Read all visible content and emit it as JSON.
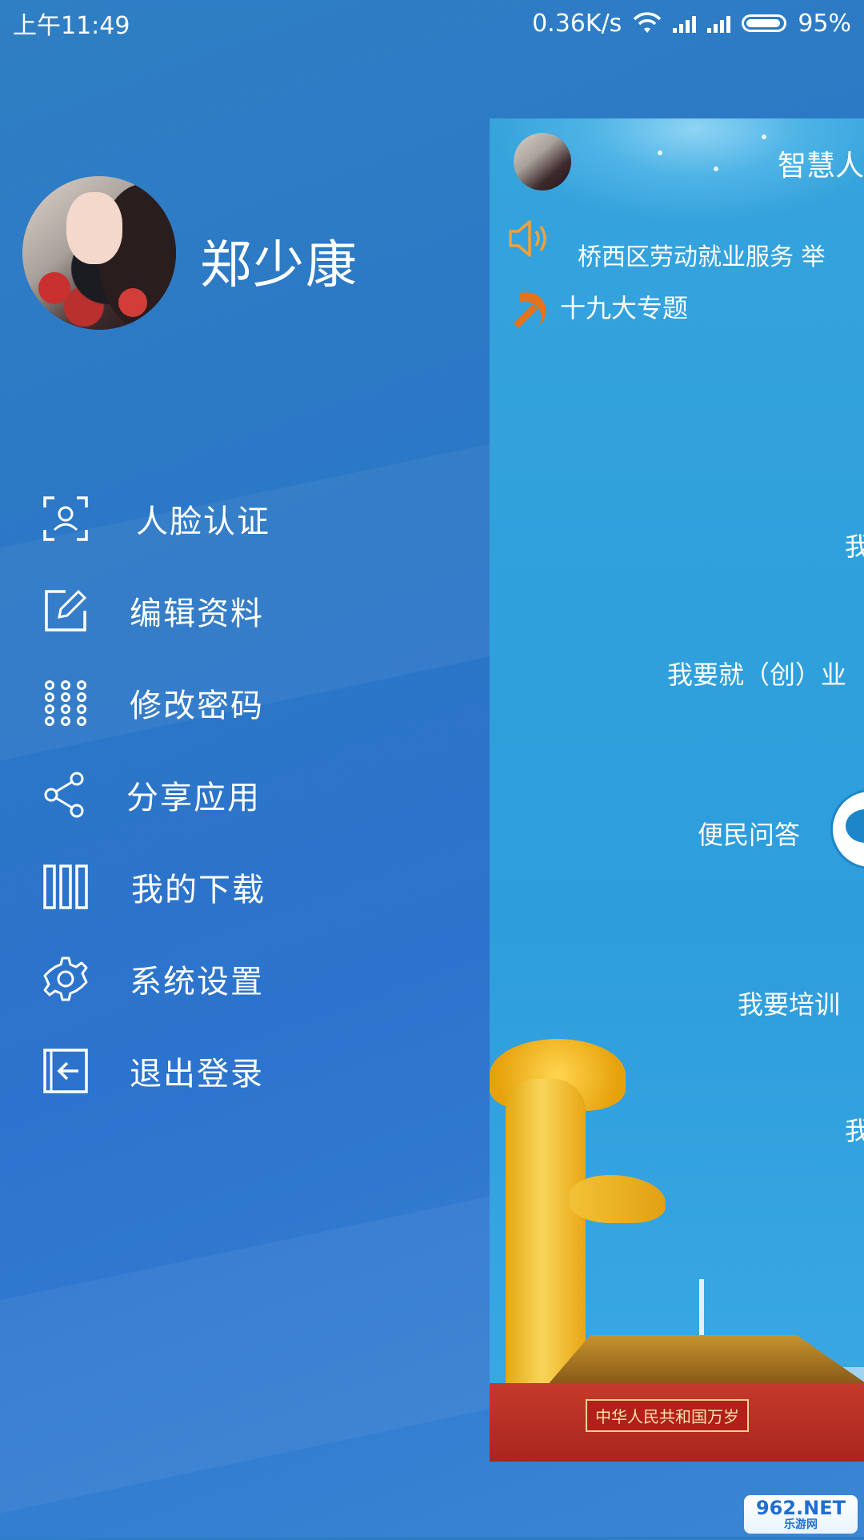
{
  "status_bar": {
    "time": "上午11:49",
    "network_speed": "0.36K/s",
    "battery": "95%"
  },
  "drawer": {
    "user_name": "郑少康",
    "menu": [
      {
        "label": "人脸认证",
        "icon": "face-scan-icon"
      },
      {
        "label": "编辑资料",
        "icon": "edit-icon"
      },
      {
        "label": "修改密码",
        "icon": "keypad-icon"
      },
      {
        "label": "分享应用",
        "icon": "share-icon"
      },
      {
        "label": "我的下载",
        "icon": "download-library-icon"
      },
      {
        "label": "系统设置",
        "icon": "gear-icon"
      },
      {
        "label": "退出登录",
        "icon": "logout-icon"
      }
    ]
  },
  "main_panel": {
    "title": "智慧人",
    "marquee": "桥西区劳动就业服务 举",
    "topic": "十九大专题",
    "links": {
      "partial_top": "我",
      "employment": "我要就（创）业",
      "qa": "便民问答",
      "training": "我要培训",
      "partial_bottom": "我"
    },
    "gate_banner": "中华人民共和国万岁"
  },
  "watermark": {
    "main": "962.NET",
    "sub": "乐游网"
  },
  "colors": {
    "drawer_bg": "#2c78c8",
    "panel_bg": "#2fa0dc",
    "text": "#ffffff",
    "accent_gold": "#e6a10b",
    "accent_red": "#c63a2c"
  }
}
